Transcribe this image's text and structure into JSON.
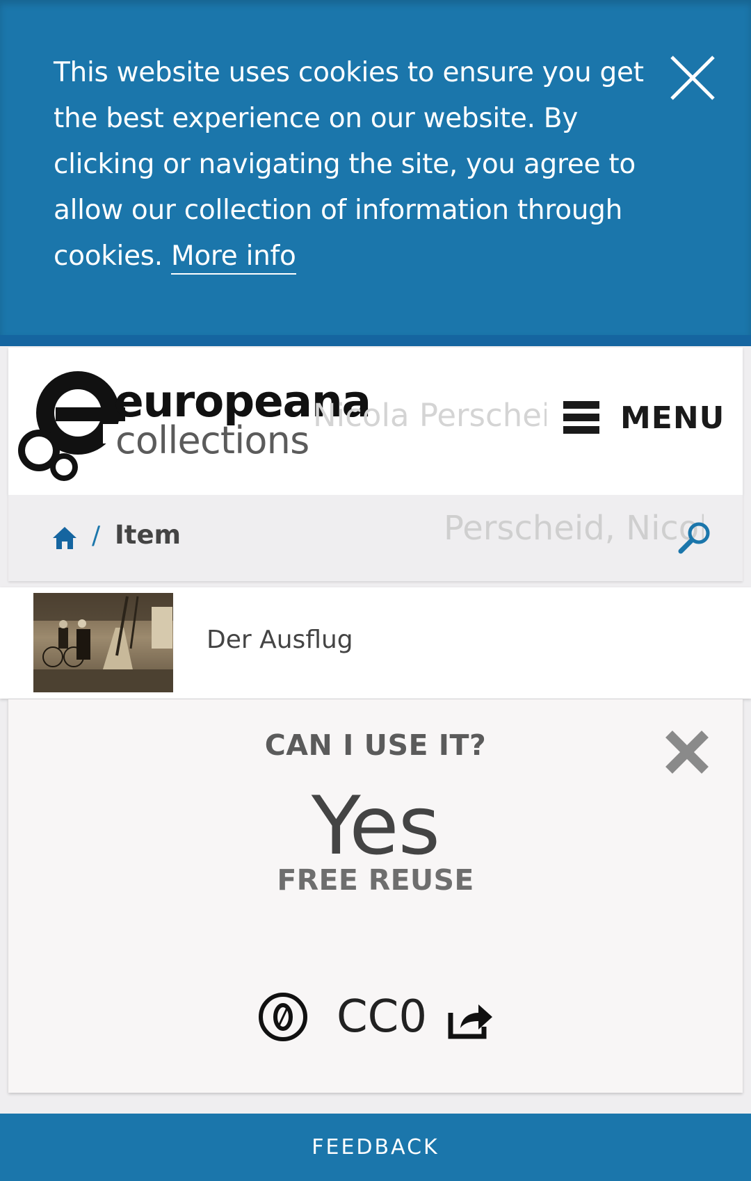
{
  "cookie_banner": {
    "text": "This website uses cookies to ensure you get the best experience on our website. By clicking or navigating the site, you agree to allow our collection of information through cookies. ",
    "link_label": "More info",
    "close_icon": "close-icon"
  },
  "header": {
    "brand_line1": "europeana",
    "brand_line2": "collections",
    "ghost_title": "Nicola Perscheid",
    "menu_label": "MENU",
    "menu_icon": "hamburger-icon"
  },
  "breadcrumb": {
    "home_icon": "home-icon",
    "separator": "/",
    "current": "Item",
    "ghost_search": "Perscheid, Nicola",
    "search_icon": "search-icon"
  },
  "item": {
    "title": "Der Ausflug"
  },
  "rights": {
    "question": "CAN I USE IT?",
    "answer": "Yes",
    "subtitle": "FREE REUSE",
    "license_label": "CC0",
    "license_icon": "cc0-icon",
    "share_icon": "external-link-icon",
    "close_icon": "close-x-icon"
  },
  "footer": {
    "feedback_label": "FEEDBACK"
  },
  "colors": {
    "accent": "#1b76ab",
    "panel": "#f8f6f6"
  }
}
